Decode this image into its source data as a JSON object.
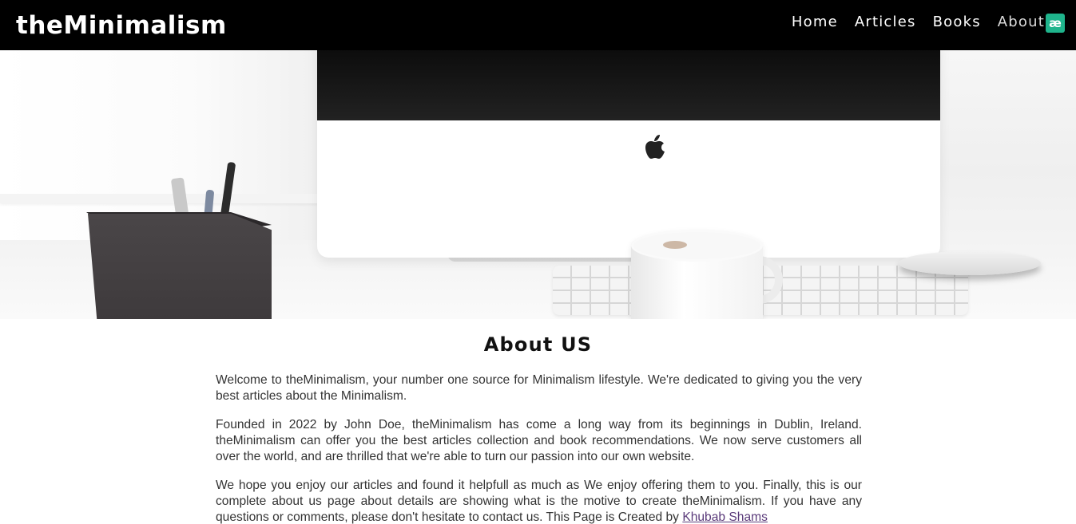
{
  "navbar": {
    "brand": "theMinimalism",
    "links": [
      "Home",
      "Articles",
      "Books",
      "About"
    ],
    "active": "About",
    "badge_text": "æ",
    "badge_color": "#1fb48c"
  },
  "hero": {
    "image_alt_description_icon": "desk-workspace-image"
  },
  "about": {
    "title": "About US",
    "paragraph1": "Welcome to theMinimalism, your number one source for Minimalism lifestyle. We're dedicated to giving you the very best articles about the Minimalism.",
    "paragraph2": "Founded in 2022 by John Doe, theMinimalism has come a long way from its beginnings in Dublin, Ireland. theMinimalism can offer you the best articles collection and book recommendations. We now serve customers all over the world, and are thrilled that we're able to turn our passion into our own website.",
    "paragraph3_text": "We hope you enjoy our articles and found it helpfull as much as We enjoy offering them to you. Finally, this is our complete about us page about details are showing what is the motive to create theMinimalism. If you have any questions or comments, please don't hesitate to contact us. This Page is Created by ",
    "author_link": "Khubab Shams"
  }
}
